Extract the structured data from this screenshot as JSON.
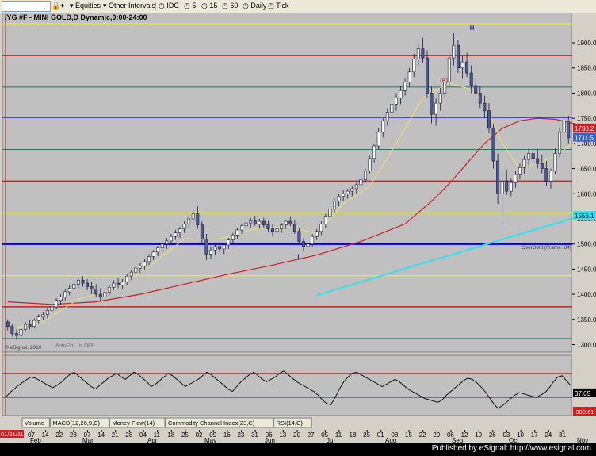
{
  "toolbar": {
    "symbol_box": "",
    "equities_label": "Equities",
    "intervals_label": "Other Intervals",
    "idc_label": "IDC",
    "i1": "5",
    "i2": "15",
    "i3": "60",
    "daily_label": "Daily",
    "tick_label": "Tick"
  },
  "title": "/YG #F - MINI GOLD,D Dynamic,0:00-24:00",
  "footer": "Published by eSignal: http://www.esignal.com",
  "tabs": [
    "Volume",
    "MACD(12,26,9,C)",
    "Money Flow(14)",
    "Commodity Channel Index(23,C)",
    "RSI(14,C)"
  ],
  "annotations": {
    "autofib": "AutoFib... is OFF",
    "copyright": "© eSignal, 2010",
    "oversold": "OverSold (Frame: 84)",
    "h_label": "H",
    "l_label": "L",
    "r_label": "(R)"
  },
  "colors": {
    "background": "#c0c0c0",
    "candle_body": "#4a5a98",
    "ma_red": "#cc1f1f",
    "ma_yellow": "#f0e070",
    "trend_cyan": "#33e0f0",
    "blue_line": "#0000d0"
  },
  "chart_data": [
    {
      "type": "candlestick",
      "ylim": [
        1285,
        1960
      ],
      "yticks": [
        "1900.0",
        "1850.0",
        "1800.0",
        "1750.0",
        "1700.0",
        "1650.0",
        "1600.0",
        "1550.0",
        "1500.0",
        "1450.0",
        "1400.0",
        "1350.0",
        "1300.0"
      ],
      "ytick_values": [
        1900,
        1850,
        1800,
        1750,
        1700,
        1650,
        1600,
        1550,
        1500,
        1450,
        1400,
        1350,
        1300
      ],
      "x_day_labels": [
        "07",
        "14",
        "22",
        "28",
        "07",
        "14",
        "21",
        "28",
        "04",
        "11",
        "18",
        "25",
        "02",
        "09",
        "16",
        "23",
        "31",
        "06",
        "13",
        "20",
        "27",
        "05",
        "11",
        "18",
        "25",
        "01",
        "08",
        "15",
        "22",
        "29",
        "06",
        "12",
        "19",
        "26",
        "03",
        "10",
        "17",
        "24",
        "31"
      ],
      "x_month_labels": [
        "Feb",
        "Mar",
        "Apr",
        "May",
        "Jun",
        "Jul",
        "Aug",
        "Sep",
        "Oct",
        "Nov"
      ],
      "x_date_label": "01/21/11",
      "last_price_label": "1711.5",
      "ma_price_label": "1730.2",
      "cyan_price_label": "1556.1",
      "ohlc": [
        [
          1345,
          1350,
          1328,
          1336
        ],
        [
          1336,
          1340,
          1316,
          1322
        ],
        [
          1322,
          1330,
          1310,
          1318
        ],
        [
          1318,
          1335,
          1312,
          1330
        ],
        [
          1330,
          1345,
          1325,
          1340
        ],
        [
          1340,
          1348,
          1330,
          1336
        ],
        [
          1336,
          1352,
          1332,
          1348
        ],
        [
          1348,
          1360,
          1342,
          1355
        ],
        [
          1355,
          1365,
          1348,
          1360
        ],
        [
          1360,
          1372,
          1352,
          1368
        ],
        [
          1368,
          1380,
          1360,
          1375
        ],
        [
          1375,
          1392,
          1370,
          1388
        ],
        [
          1388,
          1400,
          1380,
          1395
        ],
        [
          1395,
          1410,
          1388,
          1405
        ],
        [
          1405,
          1418,
          1398,
          1412
        ],
        [
          1412,
          1425,
          1405,
          1420
        ],
        [
          1420,
          1432,
          1412,
          1428
        ],
        [
          1428,
          1436,
          1415,
          1422
        ],
        [
          1422,
          1430,
          1408,
          1415
        ],
        [
          1415,
          1425,
          1400,
          1410
        ],
        [
          1410,
          1420,
          1395,
          1400
        ],
        [
          1400,
          1412,
          1385,
          1395
        ],
        [
          1395,
          1408,
          1388,
          1404
        ],
        [
          1404,
          1418,
          1398,
          1414
        ],
        [
          1414,
          1428,
          1408,
          1422
        ],
        [
          1422,
          1432,
          1412,
          1418
        ],
        [
          1418,
          1430,
          1410,
          1425
        ],
        [
          1425,
          1440,
          1418,
          1436
        ],
        [
          1436,
          1448,
          1428,
          1444
        ],
        [
          1444,
          1456,
          1436,
          1452
        ],
        [
          1452,
          1462,
          1442,
          1456
        ],
        [
          1456,
          1470,
          1448,
          1465
        ],
        [
          1465,
          1480,
          1458,
          1475
        ],
        [
          1475,
          1488,
          1468,
          1484
        ],
        [
          1484,
          1496,
          1476,
          1492
        ],
        [
          1492,
          1504,
          1484,
          1500
        ],
        [
          1500,
          1512,
          1490,
          1506
        ],
        [
          1506,
          1520,
          1498,
          1515
        ],
        [
          1515,
          1528,
          1508,
          1522
        ],
        [
          1522,
          1534,
          1512,
          1530
        ],
        [
          1530,
          1545,
          1522,
          1540
        ],
        [
          1540,
          1556,
          1532,
          1550
        ],
        [
          1550,
          1568,
          1540,
          1560
        ],
        [
          1560,
          1575,
          1530,
          1538
        ],
        [
          1538,
          1545,
          1500,
          1510
        ],
        [
          1510,
          1520,
          1468,
          1480
        ],
        [
          1480,
          1495,
          1470,
          1488
        ],
        [
          1488,
          1500,
          1478,
          1495
        ],
        [
          1495,
          1505,
          1482,
          1490
        ],
        [
          1490,
          1502,
          1480,
          1498
        ],
        [
          1498,
          1512,
          1490,
          1508
        ],
        [
          1508,
          1522,
          1500,
          1518
        ],
        [
          1518,
          1532,
          1510,
          1528
        ],
        [
          1528,
          1540,
          1520,
          1536
        ],
        [
          1536,
          1548,
          1528,
          1542
        ],
        [
          1542,
          1552,
          1532,
          1546
        ],
        [
          1546,
          1556,
          1536,
          1540
        ],
        [
          1540,
          1550,
          1530,
          1545
        ],
        [
          1545,
          1552,
          1532,
          1538
        ],
        [
          1538,
          1546,
          1525,
          1530
        ],
        [
          1530,
          1540,
          1515,
          1525
        ],
        [
          1525,
          1535,
          1515,
          1530
        ],
        [
          1530,
          1542,
          1522,
          1538
        ],
        [
          1538,
          1548,
          1530,
          1545
        ],
        [
          1545,
          1555,
          1535,
          1540
        ],
        [
          1540,
          1548,
          1520,
          1525
        ],
        [
          1525,
          1532,
          1500,
          1505
        ],
        [
          1505,
          1512,
          1485,
          1495
        ],
        [
          1495,
          1505,
          1480,
          1500
        ],
        [
          1500,
          1520,
          1495,
          1515
        ],
        [
          1515,
          1530,
          1508,
          1525
        ],
        [
          1525,
          1545,
          1518,
          1540
        ],
        [
          1540,
          1560,
          1532,
          1555
        ],
        [
          1555,
          1575,
          1548,
          1570
        ],
        [
          1570,
          1590,
          1562,
          1585
        ],
        [
          1585,
          1600,
          1575,
          1595
        ],
        [
          1595,
          1608,
          1585,
          1600
        ],
        [
          1600,
          1610,
          1590,
          1605
        ],
        [
          1605,
          1615,
          1595,
          1610
        ],
        [
          1610,
          1622,
          1600,
          1618
        ],
        [
          1618,
          1632,
          1610,
          1628
        ],
        [
          1628,
          1650,
          1622,
          1645
        ],
        [
          1645,
          1675,
          1640,
          1670
        ],
        [
          1670,
          1700,
          1662,
          1695
        ],
        [
          1695,
          1730,
          1688,
          1722
        ],
        [
          1722,
          1750,
          1712,
          1745
        ],
        [
          1745,
          1770,
          1735,
          1762
        ],
        [
          1762,
          1785,
          1750,
          1778
        ],
        [
          1778,
          1800,
          1765,
          1790
        ],
        [
          1790,
          1815,
          1778,
          1805
        ],
        [
          1805,
          1830,
          1795,
          1822
        ],
        [
          1822,
          1850,
          1812,
          1842
        ],
        [
          1842,
          1878,
          1832,
          1868
        ],
        [
          1868,
          1900,
          1855,
          1888
        ],
        [
          1888,
          1910,
          1860,
          1870
        ],
        [
          1870,
          1885,
          1790,
          1800
        ],
        [
          1800,
          1815,
          1740,
          1758
        ],
        [
          1758,
          1790,
          1735,
          1780
        ],
        [
          1780,
          1810,
          1765,
          1800
        ],
        [
          1800,
          1830,
          1790,
          1822
        ],
        [
          1822,
          1880,
          1812,
          1870
        ],
        [
          1870,
          1920,
          1855,
          1895
        ],
        [
          1895,
          1905,
          1840,
          1850
        ],
        [
          1850,
          1875,
          1830,
          1862
        ],
        [
          1862,
          1880,
          1832,
          1840
        ],
        [
          1840,
          1855,
          1800,
          1815
        ],
        [
          1815,
          1830,
          1790,
          1800
        ],
        [
          1800,
          1815,
          1770,
          1780
        ],
        [
          1780,
          1795,
          1750,
          1765
        ],
        [
          1765,
          1780,
          1720,
          1730
        ],
        [
          1730,
          1740,
          1650,
          1665
        ],
        [
          1665,
          1680,
          1580,
          1600
        ],
        [
          1600,
          1650,
          1540,
          1625
        ],
        [
          1625,
          1648,
          1598,
          1605
        ],
        [
          1605,
          1630,
          1595,
          1622
        ],
        [
          1622,
          1645,
          1612,
          1638
        ],
        [
          1638,
          1660,
          1628,
          1652
        ],
        [
          1652,
          1675,
          1640,
          1668
        ],
        [
          1668,
          1690,
          1655,
          1680
        ],
        [
          1680,
          1695,
          1660,
          1670
        ],
        [
          1670,
          1688,
          1650,
          1660
        ],
        [
          1660,
          1678,
          1640,
          1650
        ],
        [
          1650,
          1665,
          1615,
          1625
        ],
        [
          1625,
          1650,
          1610,
          1645
        ],
        [
          1645,
          1690,
          1638,
          1680
        ],
        [
          1680,
          1730,
          1672,
          1722
        ],
        [
          1722,
          1755,
          1712,
          1745
        ],
        [
          1745,
          1755,
          1700,
          1711
        ]
      ],
      "ma_red": [
        [
          0,
          1385
        ],
        [
          10,
          1380
        ],
        [
          20,
          1385
        ],
        [
          30,
          1400
        ],
        [
          40,
          1420
        ],
        [
          50,
          1440
        ],
        [
          60,
          1458
        ],
        [
          70,
          1478
        ],
        [
          80,
          1505
        ],
        [
          90,
          1540
        ],
        [
          96,
          1585
        ],
        [
          100,
          1620
        ],
        [
          104,
          1660
        ],
        [
          108,
          1700
        ],
        [
          112,
          1730
        ],
        [
          116,
          1745
        ],
        [
          120,
          1750
        ],
        [
          124,
          1748
        ],
        [
          128,
          1740
        ],
        [
          131,
          1732
        ]
      ],
      "ma_yellow": [
        [
          0,
          1330
        ],
        [
          8,
          1345
        ],
        [
          16,
          1390
        ],
        [
          24,
          1410
        ],
        [
          32,
          1455
        ],
        [
          40,
          1510
        ],
        [
          48,
          1510
        ],
        [
          56,
          1530
        ],
        [
          64,
          1535
        ],
        [
          70,
          1520
        ],
        [
          76,
          1580
        ],
        [
          82,
          1615
        ],
        [
          88,
          1700
        ],
        [
          94,
          1790
        ],
        [
          100,
          1820
        ],
        [
          104,
          1810
        ],
        [
          108,
          1780
        ],
        [
          112,
          1700
        ],
        [
          116,
          1650
        ],
        [
          120,
          1660
        ],
        [
          124,
          1675
        ],
        [
          128,
          1700
        ],
        [
          131,
          1720
        ]
      ],
      "trend_cyan": [
        [
          70,
          1398
        ],
        [
          131,
          1562
        ]
      ],
      "horizontal_lines": [
        {
          "y": 1938,
          "color": "#f0f000",
          "width": 1.2
        },
        {
          "y": 1875,
          "color": "#cc1f1f",
          "width": 1.5
        },
        {
          "y": 1812,
          "color": "#2e7060",
          "width": 1
        },
        {
          "y": 1752,
          "color": "#0000d0",
          "width": 1.5
        },
        {
          "y": 1688,
          "color": "#2e7060",
          "width": 1
        },
        {
          "y": 1625,
          "color": "#cc1f1f",
          "width": 1.5
        },
        {
          "y": 1562,
          "color": "#f0f000",
          "width": 1.5
        },
        {
          "y": 1500,
          "color": "#0000d0",
          "width": 2.5
        },
        {
          "y": 1437,
          "color": "#f0f000",
          "width": 1.2
        },
        {
          "y": 1375,
          "color": "#cc1f1f",
          "width": 1.5
        },
        {
          "y": 1312,
          "color": "#2e7060",
          "width": 1
        }
      ]
    },
    {
      "type": "line",
      "name": "RSI(14,C)",
      "ylim": [
        0,
        100
      ],
      "value_label": "37.05",
      "low_label": "-300.61",
      "levels": [
        {
          "y": 70,
          "color": "#cc1f1f"
        },
        {
          "y": 30,
          "color": "#2e7060"
        }
      ],
      "values": [
        30,
        38,
        44,
        50,
        55,
        60,
        64,
        62,
        58,
        54,
        50,
        46,
        50,
        55,
        62,
        68,
        72,
        66,
        60,
        54,
        48,
        44,
        50,
        56,
        62,
        66,
        70,
        64,
        60,
        66,
        72,
        68,
        62,
        56,
        48,
        52,
        58,
        64,
        70,
        66,
        60,
        54,
        48,
        52,
        56,
        60,
        66,
        72,
        68,
        62,
        56,
        50,
        44,
        40,
        48,
        56,
        62,
        68,
        72,
        66,
        60,
        56,
        60,
        64,
        70,
        74,
        68,
        62,
        56,
        52,
        48,
        44,
        40,
        34,
        26,
        20,
        18,
        30,
        44,
        56,
        64,
        70,
        72,
        68,
        64,
        60,
        56,
        52,
        48,
        52,
        56,
        60,
        56,
        50,
        44,
        40,
        36,
        32,
        28,
        26,
        24,
        22,
        26,
        34,
        40,
        46,
        52,
        58,
        62,
        60,
        55,
        48,
        40,
        30,
        20,
        12,
        16,
        22,
        28,
        34,
        38,
        36,
        34,
        32,
        30,
        34,
        38,
        46,
        56,
        64,
        66,
        58,
        50
      ]
    }
  ]
}
